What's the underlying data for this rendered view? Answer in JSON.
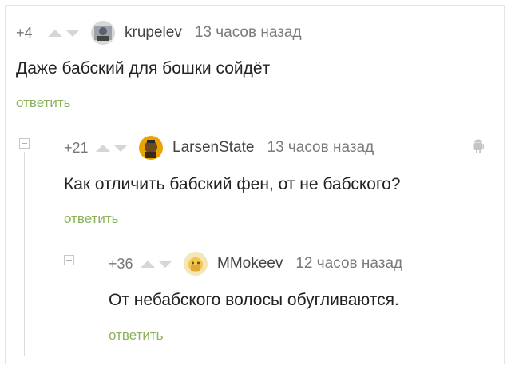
{
  "comments": [
    {
      "score": "+4",
      "author": "krupelev",
      "time": "13 часов назад",
      "text": "Даже бабский для бошки сойдёт",
      "reply": "ответить"
    },
    {
      "score": "+21",
      "author": "LarsenState",
      "time": "13 часов назад",
      "text": "Как отличить бабский фен, от не бабского?",
      "reply": "ответить"
    },
    {
      "score": "+36",
      "author": "MMokeev",
      "time": "12 часов назад",
      "text": "От небабского волосы обугливаются.",
      "reply": "ответить"
    }
  ],
  "colors": {
    "reply_link": "#8ab359",
    "vote_arrow": "#d6d6d6",
    "text": "#222222",
    "meta": "#7a7a7a"
  },
  "icons": {
    "upvote": "triangle-up-icon",
    "downvote": "triangle-down-icon",
    "collapse": "minus-square-icon",
    "mobile": "android-icon"
  }
}
